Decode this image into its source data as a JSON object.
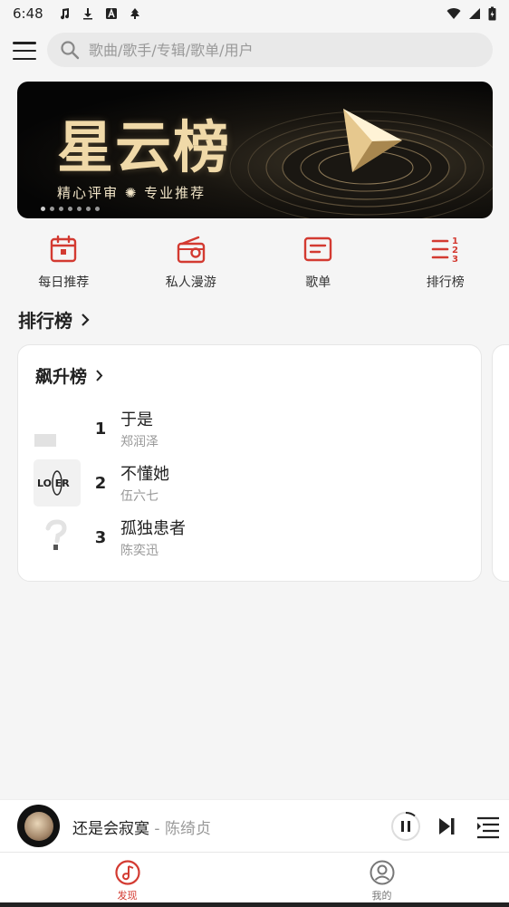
{
  "status_bar": {
    "time": "6:48"
  },
  "search": {
    "placeholder": "歌曲/歌手/专辑/歌单/用户"
  },
  "banner": {
    "title": "星云榜",
    "subtitle_left": "精心评审",
    "subtitle_right": "专业推荐",
    "dot_count": 7,
    "active_dot": 0
  },
  "quick_nav": [
    {
      "label": "每日推荐",
      "icon": "calendar-icon"
    },
    {
      "label": "私人漫游",
      "icon": "radio-icon"
    },
    {
      "label": "歌单",
      "icon": "playlist-icon"
    },
    {
      "label": "排行榜",
      "icon": "ranking-icon"
    }
  ],
  "section": {
    "title": "排行榜"
  },
  "chart_card": {
    "title": "飙升榜",
    "songs": [
      {
        "rank": "1",
        "name": "于是",
        "artist": "郑润泽"
      },
      {
        "rank": "2",
        "name": "不懂她",
        "artist": "伍六七"
      },
      {
        "rank": "3",
        "name": "孤独患者",
        "artist": "陈奕迅"
      }
    ]
  },
  "player": {
    "song": "还是会寂寞",
    "separator": " - ",
    "artist": "陈绮贞"
  },
  "bottom_nav": [
    {
      "label": "发现",
      "icon": "music-note-icon",
      "active": true
    },
    {
      "label": "我的",
      "icon": "user-icon",
      "active": false
    }
  ],
  "colors": {
    "accent": "#d33a31",
    "background": "#f5f5f5"
  }
}
